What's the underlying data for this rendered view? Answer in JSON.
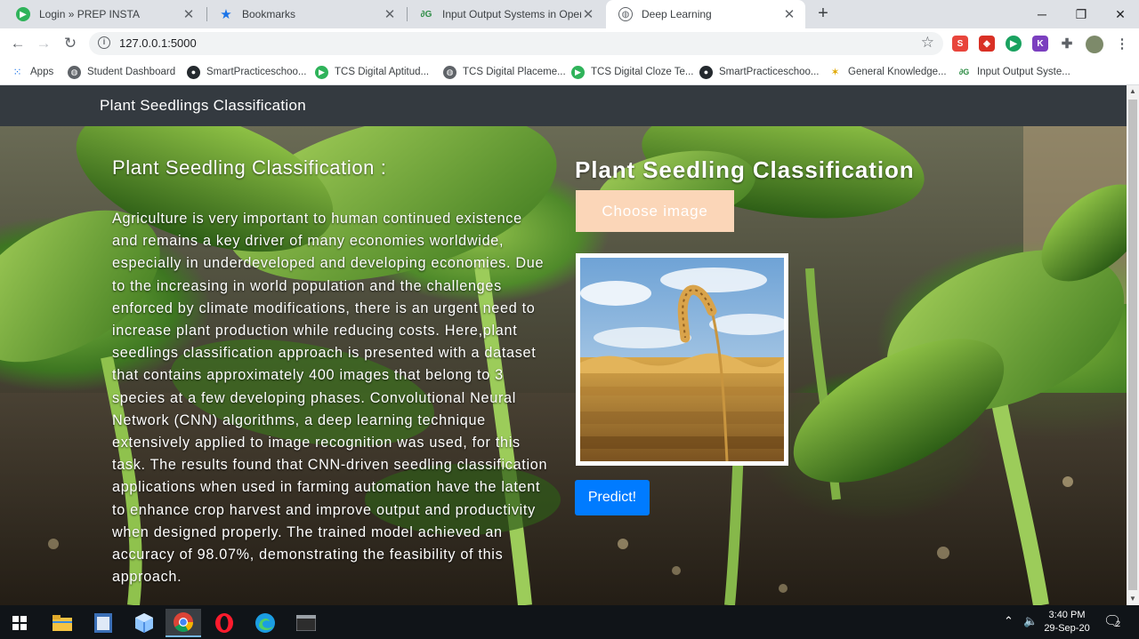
{
  "browser": {
    "tabs": [
      {
        "title": "Login » PREP INSTA",
        "icon": "prepinsta-icon",
        "close": "✕"
      },
      {
        "title": "Bookmarks",
        "icon": "star-icon",
        "close": "✕"
      },
      {
        "title": "Input Output Systems in Operatin",
        "icon": "geeks-icon",
        "close": "✕"
      },
      {
        "title": "Deep Learning",
        "icon": "globe-icon",
        "close": "✕"
      }
    ],
    "new_tab": "+",
    "window_controls": {
      "minimize": "─",
      "maximize": "❐",
      "close": "✕"
    },
    "url": "127.0.0.1:5000",
    "bookmarks": [
      {
        "label": "Apps",
        "icon": "apps-grid-icon"
      },
      {
        "label": "Student Dashboard",
        "icon": "globe-icon"
      },
      {
        "label": "SmartPracticeschoo...",
        "icon": "github-icon"
      },
      {
        "label": "TCS Digital Aptitud...",
        "icon": "prepinsta-icon"
      },
      {
        "label": "TCS Digital Placeme...",
        "icon": "globe-icon"
      },
      {
        "label": "TCS Digital Cloze Te...",
        "icon": "prepinsta-icon"
      },
      {
        "label": "SmartPracticeschoo...",
        "icon": "github-icon"
      },
      {
        "label": "General Knowledge...",
        "icon": "gk-icon"
      },
      {
        "label": "Input Output Syste...",
        "icon": "geeks-icon"
      }
    ],
    "accent": "#1a73e8"
  },
  "app": {
    "brand": "Plant Seedlings Classification",
    "left_title": "Plant Seedling Classification :",
    "description": "Agriculture is very important to human continued existence and remains a key driver of many economies worldwide, especially in underdeveloped and developing economies. Due to the increasing in world population and the challenges enforced by climate modifications, there is an urgent need to increase plant production while reducing costs. Here,plant seedlings classification approach is presented with a dataset that contains approximately 400 images that belong to 3 species at a few developing phases. Convolutional Neural Network (CNN) algorithms, a deep learning technique extensively applied to image recognition was used, for this task. The results found that CNN-driven seedling classification applications when used in farming automation have the latent to enhance crop harvest and improve output and productivity when designed properly. The trained model achieved an accuracy of 98.07%, demonstrating the feasibility of this approach.",
    "right_title": "Plant Seedling Classification",
    "choose_label": "Choose image",
    "predict_label": "Predict!",
    "colors": {
      "navbar": "#343a40",
      "choose_bg": "#fbd6b8",
      "predict_bg": "#007bff"
    }
  },
  "taskbar": {
    "time": "3:40 PM",
    "date": "29-Sep-20",
    "notifications": "2"
  }
}
